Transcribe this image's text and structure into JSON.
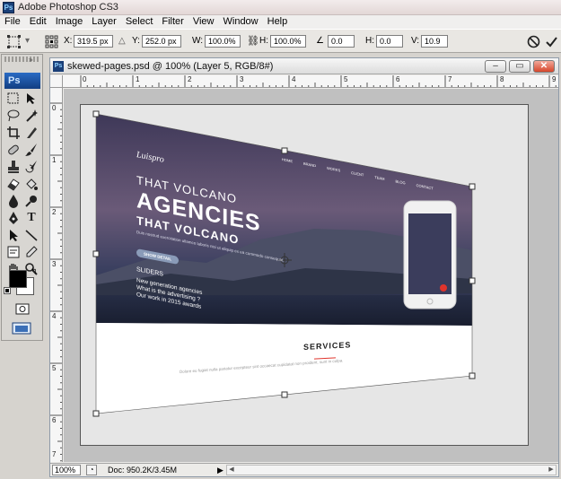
{
  "app": {
    "title": "Adobe Photoshop CS3",
    "logo": "Ps"
  },
  "menu": [
    "File",
    "Edit",
    "Image",
    "Layer",
    "Select",
    "Filter",
    "View",
    "Window",
    "Help"
  ],
  "options": {
    "x_label": "X:",
    "x_value": "319.5 px",
    "y_label": "Y:",
    "y_value": "252.0 px",
    "w_label": "W:",
    "w_value": "100.0%",
    "h_label": "H:",
    "h_value": "100.0%",
    "rot_value": "0.0",
    "hskew_label": "H:",
    "hskew_value": "0.0",
    "vskew_label": "V:",
    "vskew_value": "10.9"
  },
  "tools": {
    "badge": "Ps"
  },
  "document": {
    "title": "skewed-pages.psd @ 100% (Layer 5, RGB/8#)",
    "zoom": "100%",
    "doc_info": "Doc: 950.2K/3.45M",
    "ruler_top": [
      "0",
      "1",
      "2",
      "3",
      "4",
      "5",
      "6",
      "7",
      "8",
      "9"
    ],
    "ruler_left": [
      "0",
      "1",
      "2",
      "3",
      "4",
      "5",
      "6",
      "7"
    ]
  },
  "page": {
    "logo": "Luispro",
    "nav": [
      "HOME",
      "BRAND",
      "WORKS",
      "CLIENT",
      "TEAM",
      "BLOG",
      "CONTACT"
    ],
    "headline_small": "THAT VOLCANO",
    "headline_big": "AGENCIES",
    "headline_sub": "THAT VOLCANO",
    "body": "Duis nostrud exercitation ullamco laboris nisi ut aliquip ex ea commodo consequat.",
    "button": "SHOW DETAIL",
    "sliders_label": "SLIDERS",
    "slider_lines": [
      "New generation agencies",
      "What is the advertising ?",
      "Our work in 2015 awards"
    ],
    "services_title": "SERVICES",
    "services_text": "Dolore eu fugiat nulla pariatur excepteur sint occaecat cupidatat non proident, sunt in culpa."
  },
  "colors": {
    "ps_blue": "#1a3f78",
    "close_red": "#d6462b",
    "canvas_gray": "#c0c0c0",
    "hero_dark": "#2c3150",
    "accent_red": "#e0342c"
  }
}
